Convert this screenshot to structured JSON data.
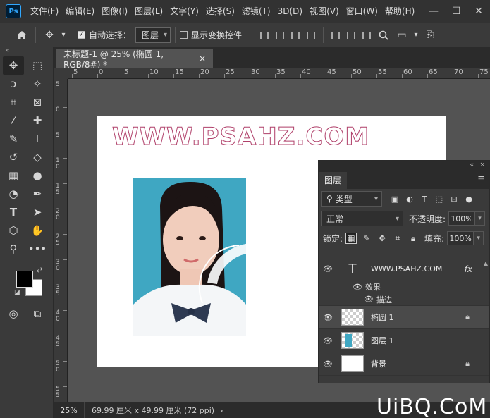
{
  "app": {
    "logo": "Ps"
  },
  "menu": [
    "文件(F)",
    "编辑(E)",
    "图像(I)",
    "图层(L)",
    "文字(Y)",
    "选择(S)",
    "滤镜(T)",
    "3D(D)",
    "视图(V)",
    "窗口(W)",
    "帮助(H)"
  ],
  "window_controls": {
    "minimize": "—",
    "maximize": "☐",
    "close": "✕"
  },
  "options": {
    "auto_select_label": "自动选择：",
    "auto_select_value": "图层",
    "show_transform_label": "显示变换控件"
  },
  "document": {
    "tab_title": "未标题-1 @ 25% (椭圆 1, RGB/8#) *",
    "tab_close": "×",
    "canvas_text": "WWW.PSAHZ.COM"
  },
  "ruler": {
    "h_labels": [
      "5",
      "0",
      "5",
      "10",
      "15",
      "20",
      "25",
      "30",
      "35",
      "40",
      "45",
      "50",
      "55",
      "60",
      "65",
      "70",
      "75"
    ],
    "v_labels": [
      "5",
      "0",
      "5",
      "1\n0",
      "1\n5",
      "2\n0",
      "2\n5",
      "3\n0",
      "3\n5",
      "4\n0",
      "4\n5",
      "5\n0",
      "5\n5"
    ]
  },
  "status": {
    "zoom": "25%",
    "doc_info": "69.99 厘米 x 49.99 厘米 (72 ppi)",
    "arrow": "›"
  },
  "layers_panel": {
    "collapse": "«",
    "close": "×",
    "tab": "图层",
    "filter_kind": "类型",
    "blend_mode": "正常",
    "opacity_label": "不透明度:",
    "opacity_value": "100%",
    "lock_label": "锁定:",
    "fill_label": "填充:",
    "fill_value": "100%",
    "layers": [
      {
        "name": "WWW.PSAHZ.COM",
        "type": "text",
        "fx": "fx",
        "effects_label": "效果",
        "effect": "描边"
      },
      {
        "name": "椭圆 1",
        "type": "shape",
        "selected": true,
        "locked": true
      },
      {
        "name": "图层 1",
        "type": "pixel"
      },
      {
        "name": "背景",
        "type": "background",
        "locked": true
      }
    ]
  },
  "watermark": "UiBQ.CoM",
  "colors": {
    "accent": "#31a8ff",
    "canvas_text_stroke": "#b0406a",
    "photo_bg": "#3fa7c2",
    "arrow": "#e53935"
  }
}
